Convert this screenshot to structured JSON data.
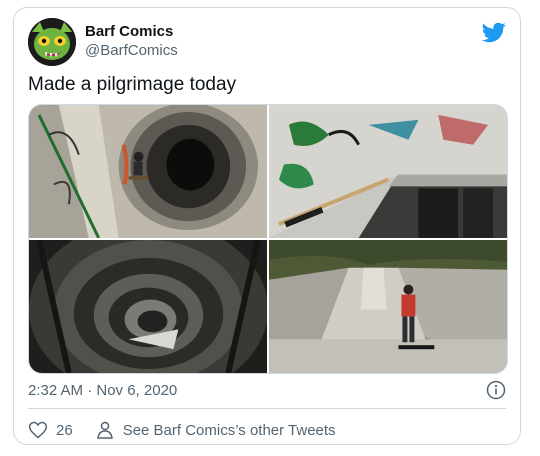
{
  "tweet": {
    "display_name": "Barf Comics",
    "handle": "@BarfComics",
    "text": "Made a pilgrimage today",
    "timestamp": "2:32 AM · Nov 6, 2020",
    "like_count": "26",
    "other_tweets_label": "See Barf Comics’s other Tweets",
    "brand_color": "#1d9bf0"
  },
  "media": {
    "photo_count": 4
  }
}
